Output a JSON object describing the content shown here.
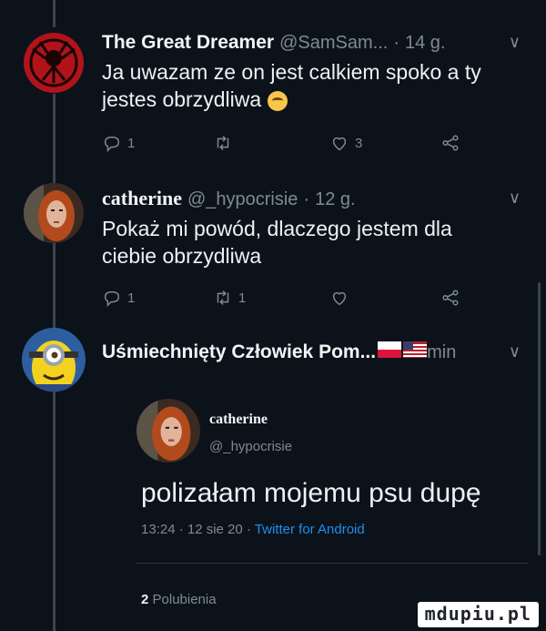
{
  "tweets": [
    {
      "author": "The Great Dreamer",
      "handle": "@SamSam...",
      "time": "14 g.",
      "text_line1": "Ja uwazam ze on jest calkiem spoko a ty",
      "text_line2": "jestes obrzydliwa",
      "emoji_icon": "face-emoji-icon",
      "reply_count": "1",
      "retweet_count": "",
      "like_count": "3"
    },
    {
      "author": "catherine",
      "handle": "@_hypocrisie",
      "time": "12 g.",
      "text_line1": "Pokaż mi powód, dlaczego jestem dla",
      "text_line2": "ciebie obrzydliwa",
      "reply_count": "1",
      "retweet_count": "1",
      "like_count": ""
    }
  ],
  "detail": {
    "author": "Uśmiechnięty Człowiek Pom...",
    "flag_icon": "poland-usa-flag-icon",
    "time_suffix": "min",
    "quote_name": "catherine",
    "quote_handle": "@_hypocrisie",
    "text": "polizałam mojemu psu dupę",
    "timestamp": "13:24 · 12 sie 20 ·",
    "client": "Twitter for Android",
    "likes_count": "2",
    "likes_label": "Polubienia"
  },
  "watermark": "mdupiu.pl",
  "colors": {
    "background": "#0c121a",
    "text": "#eef1f4",
    "muted": "#7e8a96",
    "link": "#1d8ff0"
  }
}
